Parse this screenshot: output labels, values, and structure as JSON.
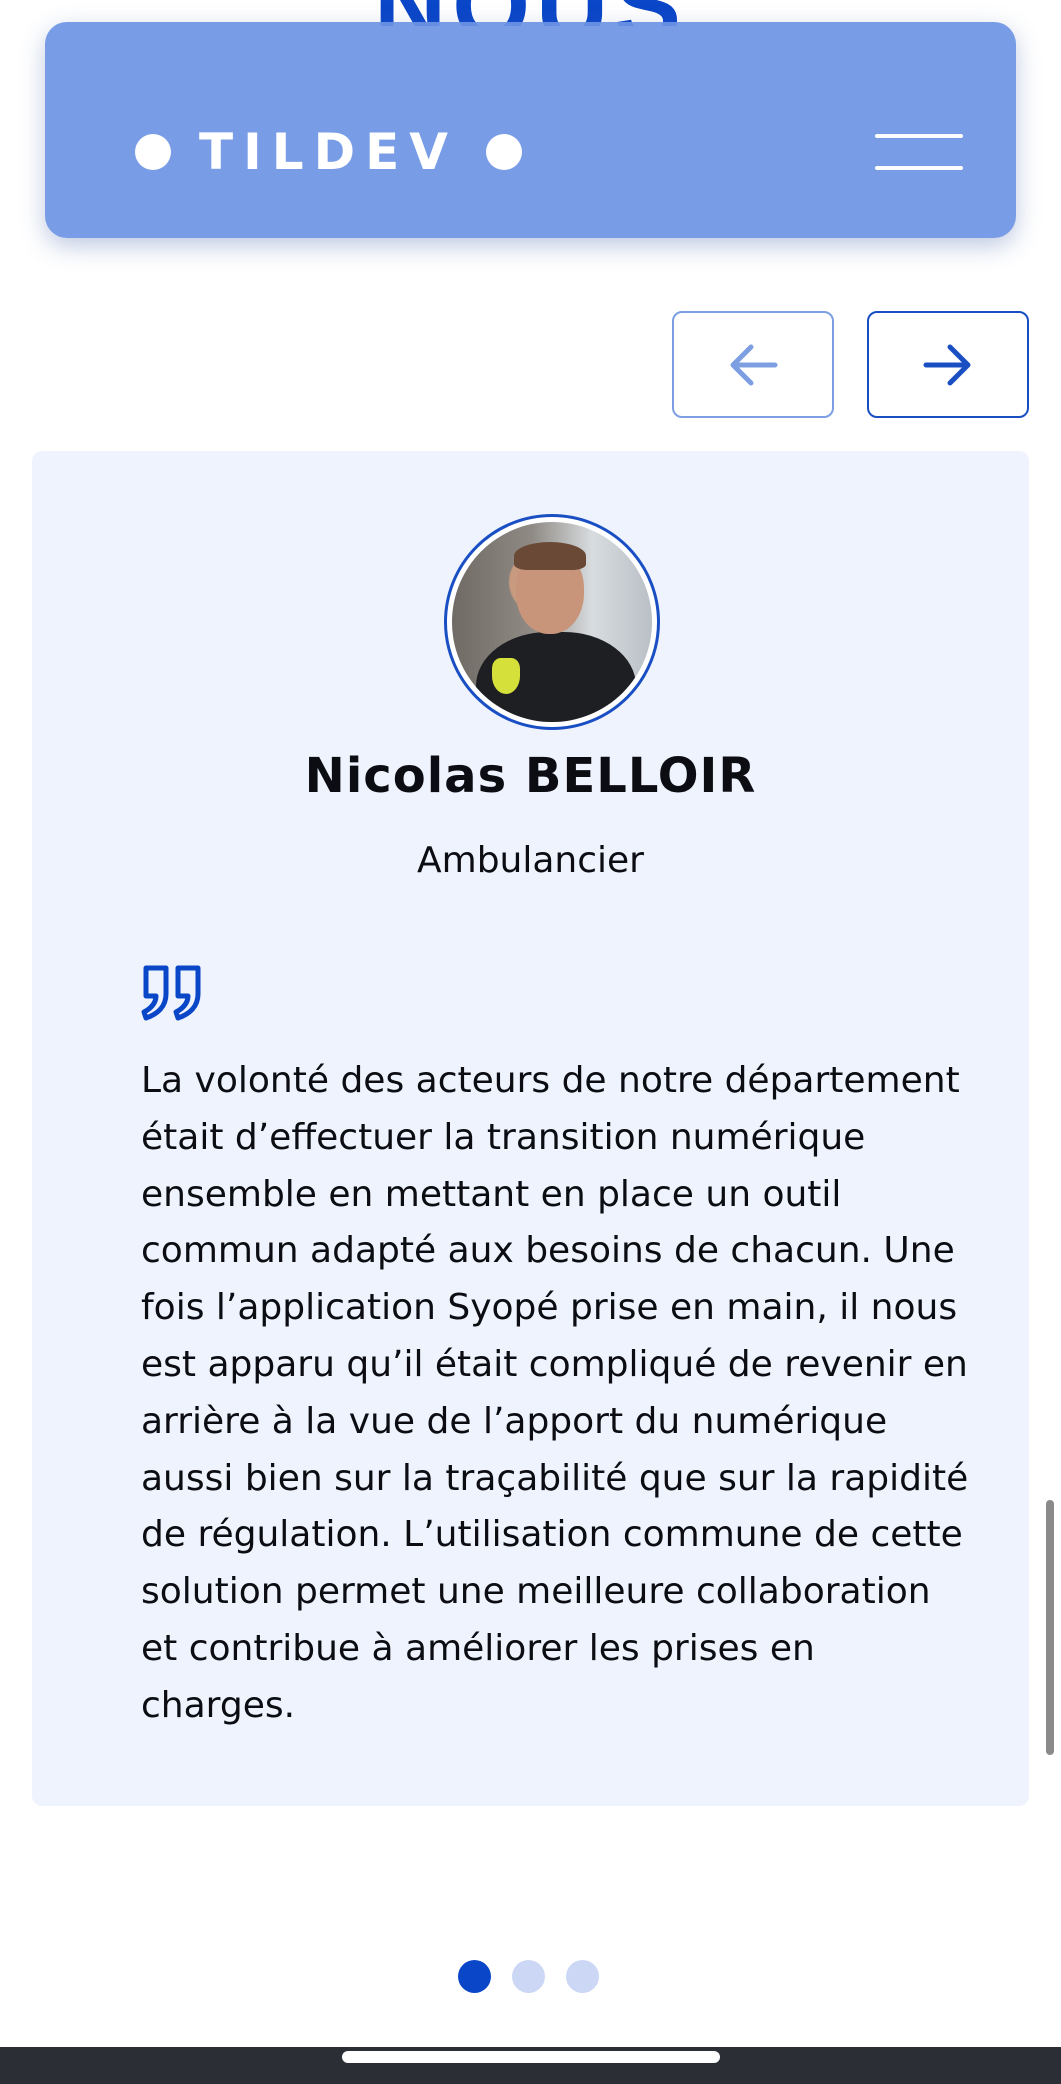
{
  "background_heading": "NOUS",
  "header": {
    "logo_text": "TILDEV",
    "menu_icon": "hamburger-menu-icon"
  },
  "carousel": {
    "prev_icon": "arrow-left-icon",
    "next_icon": "arrow-right-icon",
    "dots_count": 3,
    "active_index": 0
  },
  "testimonial": {
    "name": "Nicolas BELLOIR",
    "role": "Ambulancier",
    "quote_icon": "quote-icon",
    "quote": "La volonté des acteurs de notre département était d’effectuer la transition numérique ensemble en mettant en place un outil commun adapté aux besoins de chacun. Une fois l’application Syopé prise en main, il nous est apparu qu’il était compliqué de revenir en arrière à la vue de l’apport du numérique aussi bien sur la traçabilité que sur la rapidité de régulation. L’utilisation commune de cette solution permet une meilleure collaboration et contribue à améliorer les prises en charges."
  },
  "colors": {
    "accent": "#0a46c8",
    "header_bg": "#6e94e4",
    "card_bg": "#eff3fd",
    "dot_inactive": "#cbd7f4"
  }
}
